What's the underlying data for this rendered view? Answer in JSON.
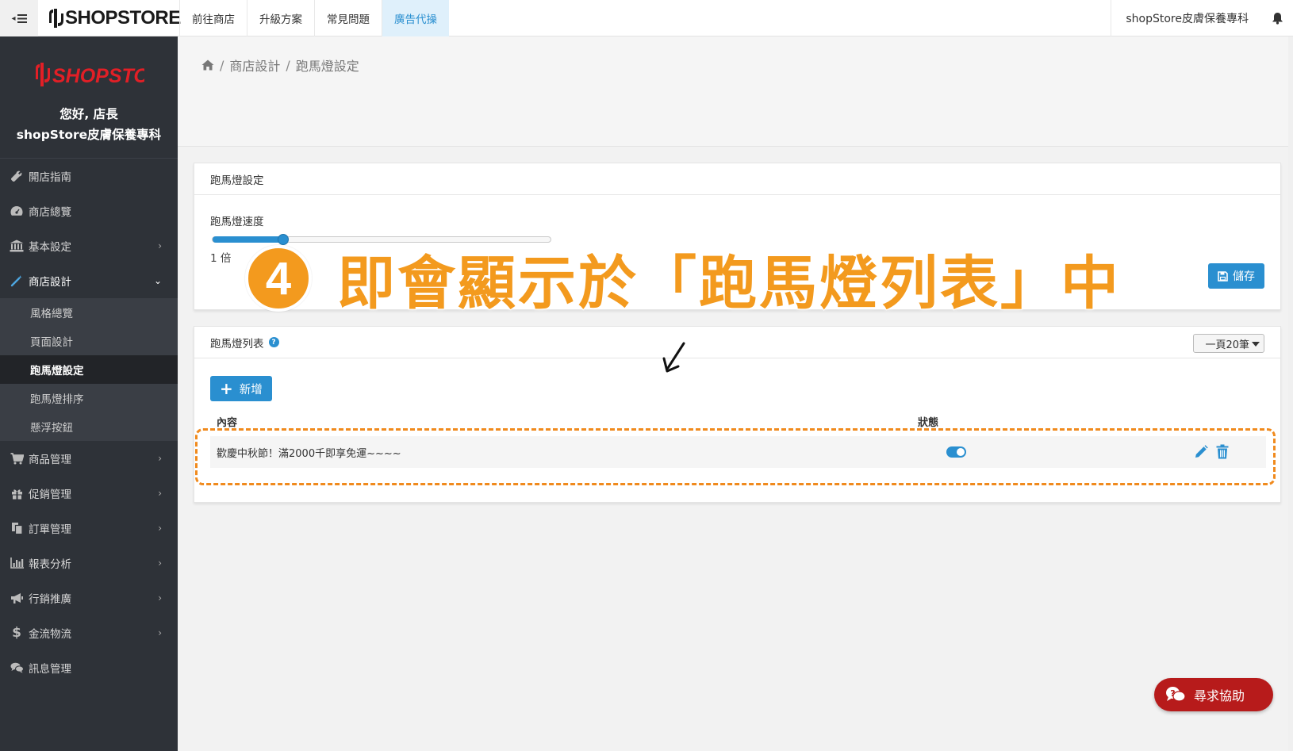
{
  "topbar": {
    "logo_text": "SHOPSTORE",
    "nav": [
      "前往商店",
      "升級方案",
      "常見問題",
      "廣告代操"
    ],
    "active_nav_index": 3,
    "store_name": "shopStore皮膚保養專科"
  },
  "sidebar": {
    "logo_text": "SHOPSTORE",
    "greeting": "您好, 店長",
    "store_name": "shopStore皮膚保養專科",
    "menu": [
      {
        "label": "開店指南",
        "icon": "wrench-icon",
        "has_children": false
      },
      {
        "label": "商店總覽",
        "icon": "dashboard-icon",
        "has_children": false
      },
      {
        "label": "基本設定",
        "icon": "bank-icon",
        "has_children": true
      },
      {
        "label": "商店設計",
        "icon": "magic-wand-icon",
        "has_children": true,
        "expanded": true
      },
      {
        "label": "商品管理",
        "icon": "cart-icon",
        "has_children": true
      },
      {
        "label": "促銷管理",
        "icon": "gift-icon",
        "has_children": true
      },
      {
        "label": "訂單管理",
        "icon": "copy-icon",
        "has_children": true
      },
      {
        "label": "報表分析",
        "icon": "bar-chart-icon",
        "has_children": true
      },
      {
        "label": "行銷推廣",
        "icon": "bullhorn-icon",
        "has_children": true
      },
      {
        "label": "金流物流",
        "icon": "dollar-icon",
        "has_children": true
      },
      {
        "label": "訊息管理",
        "icon": "comments-icon",
        "has_children": false
      }
    ],
    "submenu": [
      "風格總覽",
      "頁面設計",
      "跑馬燈設定",
      "跑馬燈排序",
      "懸浮按鈕"
    ],
    "active_submenu_index": 2
  },
  "breadcrumb": [
    "商店設計",
    "跑馬燈設定"
  ],
  "settings_panel": {
    "title": "跑馬燈設定",
    "speed_label": "跑馬燈速度",
    "speed_fraction": 0.21,
    "speed_value": "1 倍",
    "save_label": "儲存"
  },
  "list_panel": {
    "title": "跑馬燈列表",
    "per_page": "一頁20筆",
    "add_label": "新增",
    "columns": [
      "內容",
      "狀態"
    ],
    "rows": [
      {
        "content": "歡慶中秋節！滿2000千即享免運~~~~",
        "enabled": true
      }
    ]
  },
  "annotation": {
    "step": "4",
    "text": "即會顯示於「跑馬燈列表」中"
  },
  "help_button": "尋求協助",
  "colors": {
    "accent": "#2a8fd0",
    "sidebar_bg": "#2e3238",
    "annotation_orange": "#f39a1e",
    "help_red": "#b71b1b",
    "logo_red": "#e21f26"
  }
}
